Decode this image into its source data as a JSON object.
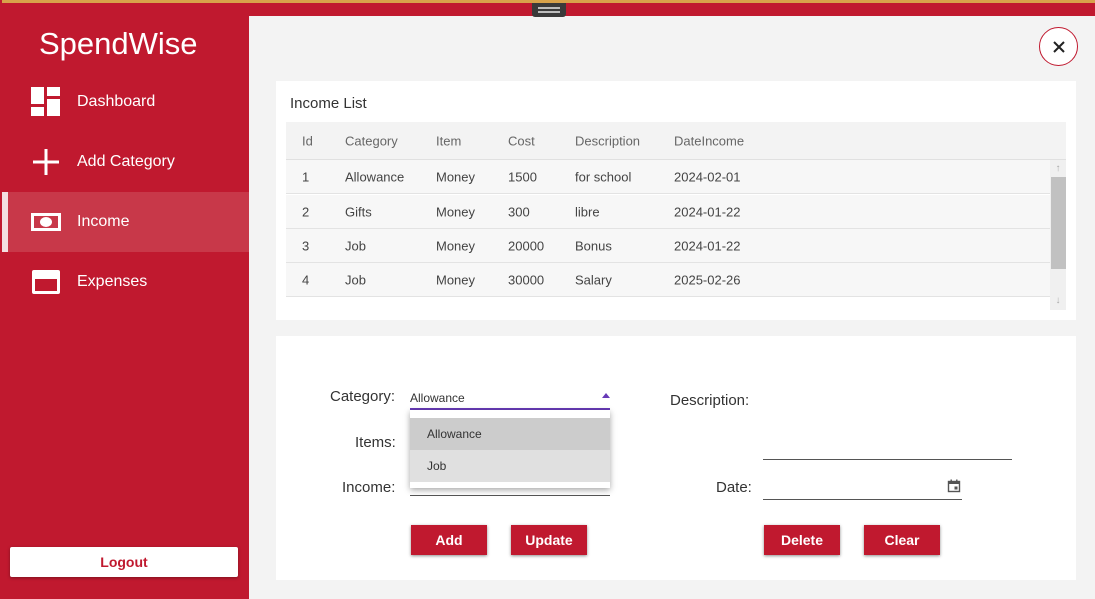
{
  "app": {
    "title": "SpendWise",
    "accent": "#c0192f"
  },
  "sidebar": {
    "items": [
      {
        "label": "Dashboard",
        "icon": "dashboard-icon"
      },
      {
        "label": "Add Category",
        "icon": "plus-icon"
      },
      {
        "label": "Income",
        "icon": "money-icon",
        "active": true
      },
      {
        "label": "Expenses",
        "icon": "credit-card-icon"
      }
    ],
    "logout_label": "Logout"
  },
  "close_icon": "close-icon",
  "income_list": {
    "title": "Income List",
    "columns": [
      "Id",
      "Category",
      "Item",
      "Cost",
      "Description",
      "DateIncome"
    ],
    "rows": [
      [
        "1",
        "Allowance",
        "Money",
        "1500",
        "for school",
        "2024-02-01"
      ],
      [
        "2",
        "Gifts",
        "Money",
        "300",
        "libre",
        "2024-01-22"
      ],
      [
        "3",
        "Job",
        "Money",
        "20000",
        "Bonus",
        "2024-01-22"
      ],
      [
        "4",
        "Job",
        "Money",
        "30000",
        "Salary",
        "2025-02-26"
      ]
    ]
  },
  "form": {
    "category_label": "Category:",
    "category_value": "Allowance",
    "category_options": [
      "Allowance",
      "Job"
    ],
    "items_label": "Items:",
    "income_label": "Income:",
    "description_label": "Description:",
    "date_label": "Date:",
    "buttons": {
      "add": "Add",
      "update": "Update",
      "delete": "Delete",
      "clear": "Clear"
    }
  }
}
